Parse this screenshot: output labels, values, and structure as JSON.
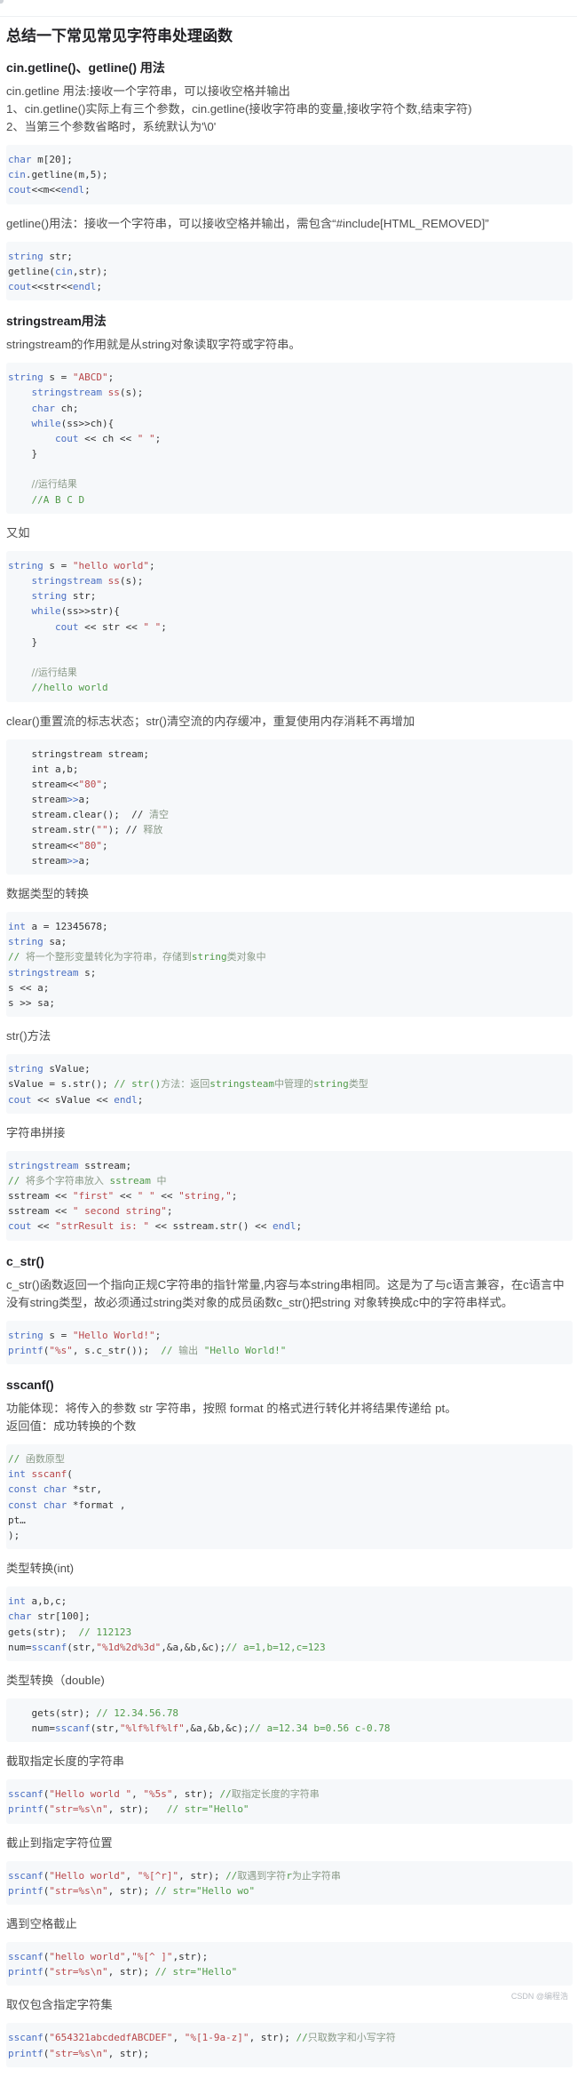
{
  "title": "总结一下常见常见字符串处理函数",
  "sections": [
    {
      "type": "h2",
      "text": "cin.getline()、getline() 用法"
    },
    {
      "type": "p",
      "lines": [
        "cin.getline 用法:接收一个字符串，可以接收空格并输出",
        "1、cin.getline()实际上有三个参数，cin.getline(接收字符串的变量,接收字符个数,结束字符)",
        "2、当第三个参数省略时，系统默认为'\\0'"
      ]
    },
    {
      "type": "code",
      "lines": [
        [
          [
            "kw",
            "char"
          ],
          [
            "p",
            " m[20];"
          ]
        ],
        [
          [
            "kw",
            "cin"
          ],
          [
            "p",
            ".getline(m,5);"
          ]
        ],
        [
          [
            "kw",
            "cout"
          ],
          [
            "p",
            "<<m<<"
          ],
          [
            "kw",
            "endl"
          ],
          [
            "p",
            ";"
          ]
        ]
      ]
    },
    {
      "type": "p",
      "lines": [
        "getline()用法：接收一个字符串，可以接收空格并输出，需包含“#include[HTML_REMOVED]”"
      ]
    },
    {
      "type": "code",
      "lines": [
        [
          [
            "kw",
            "string"
          ],
          [
            "p",
            " str;"
          ]
        ],
        [
          [
            "p",
            "getline("
          ],
          [
            "kw",
            "cin"
          ],
          [
            "p",
            ",str);"
          ]
        ],
        [
          [
            "kw",
            "cout"
          ],
          [
            "p",
            "<<str<<"
          ],
          [
            "kw",
            "endl"
          ],
          [
            "p",
            ";"
          ]
        ]
      ]
    },
    {
      "type": "h2",
      "text": "stringstream用法"
    },
    {
      "type": "p",
      "lines": [
        "stringstream的作用就是从string对象读取字符或字符串。"
      ]
    },
    {
      "type": "code",
      "lines": [
        [
          [
            "kw",
            "string"
          ],
          [
            "p",
            " s = "
          ],
          [
            "str",
            "\"ABCD\""
          ],
          [
            "p",
            ";"
          ]
        ],
        [
          [
            "p",
            "    "
          ],
          [
            "kw",
            "stringstream"
          ],
          [
            "p",
            " "
          ],
          [
            "fn",
            "ss"
          ],
          [
            "p",
            "(s);"
          ]
        ],
        [
          [
            "p",
            "    "
          ],
          [
            "kw",
            "char"
          ],
          [
            "p",
            " ch;"
          ]
        ],
        [
          [
            "p",
            "    "
          ],
          [
            "kw",
            "while"
          ],
          [
            "p",
            "(ss>>ch){"
          ]
        ],
        [
          [
            "p",
            "        "
          ],
          [
            "kw",
            "cout"
          ],
          [
            "p",
            " << ch << "
          ],
          [
            "str",
            "\" \""
          ],
          [
            "p",
            ";"
          ]
        ],
        [
          [
            "p",
            "    }"
          ]
        ],
        [
          [
            "p",
            ""
          ]
        ],
        [
          [
            "p",
            "    "
          ],
          [
            "cmcn",
            "//运行结果"
          ]
        ],
        [
          [
            "p",
            "    "
          ],
          [
            "cm",
            "//A B C D"
          ]
        ]
      ]
    },
    {
      "type": "label",
      "text": "又如"
    },
    {
      "type": "code",
      "lines": [
        [
          [
            "kw",
            "string"
          ],
          [
            "p",
            " s = "
          ],
          [
            "str",
            "\"hello world\""
          ],
          [
            "p",
            ";"
          ]
        ],
        [
          [
            "p",
            "    "
          ],
          [
            "kw",
            "stringstream"
          ],
          [
            "p",
            " "
          ],
          [
            "fn",
            "ss"
          ],
          [
            "p",
            "(s);"
          ]
        ],
        [
          [
            "p",
            "    "
          ],
          [
            "kw",
            "string"
          ],
          [
            "p",
            " str;"
          ]
        ],
        [
          [
            "p",
            "    "
          ],
          [
            "kw",
            "while"
          ],
          [
            "p",
            "(ss>>str){"
          ]
        ],
        [
          [
            "p",
            "        "
          ],
          [
            "kw",
            "cout"
          ],
          [
            "p",
            " << str << "
          ],
          [
            "str",
            "\" \""
          ],
          [
            "p",
            ";"
          ]
        ],
        [
          [
            "p",
            "    }"
          ]
        ],
        [
          [
            "p",
            ""
          ]
        ],
        [
          [
            "p",
            "    "
          ],
          [
            "cmcn",
            "//运行结果"
          ]
        ],
        [
          [
            "p",
            "    "
          ],
          [
            "cm",
            "//hello world"
          ]
        ]
      ]
    },
    {
      "type": "label",
      "text": "clear()重置流的标志状态；str()清空流的内存缓冲，重复使用内存消耗不再增加"
    },
    {
      "type": "code",
      "lines": [
        [
          [
            "p",
            "    stringstream stream;"
          ]
        ],
        [
          [
            "p",
            "    int a,b;"
          ]
        ],
        [
          [
            "p",
            "    stream<<"
          ],
          [
            "str",
            "\"80\""
          ],
          [
            "p",
            ";"
          ]
        ],
        [
          [
            "p",
            "    stream"
          ],
          [
            "kw",
            ">>"
          ],
          [
            "p",
            "a;"
          ]
        ],
        [
          [
            "p",
            "    stream.clear();  // "
          ],
          [
            "cmcn",
            "清空"
          ]
        ],
        [
          [
            "p",
            "    stream.str("
          ],
          [
            "str",
            "\"\""
          ],
          [
            "p",
            "); // "
          ],
          [
            "cmcn",
            "释放"
          ]
        ],
        [
          [
            "p",
            "    stream<<"
          ],
          [
            "str",
            "\"80\""
          ],
          [
            "p",
            ";"
          ]
        ],
        [
          [
            "p",
            "    stream"
          ],
          [
            "kw",
            ">>"
          ],
          [
            "p",
            "a;"
          ]
        ]
      ]
    },
    {
      "type": "label",
      "text": "数据类型的转换"
    },
    {
      "type": "code",
      "lines": [
        [
          [
            "kw",
            "int"
          ],
          [
            "p",
            " a = 12345678;"
          ]
        ],
        [
          [
            "kw",
            "string"
          ],
          [
            "p",
            " sa;"
          ]
        ],
        [
          [
            "cm",
            "// "
          ],
          [
            "cmcn",
            "将一个整形变量转化为字符串，存储到"
          ],
          [
            "cm",
            "string"
          ],
          [
            "cmcn",
            "类对象中"
          ]
        ],
        [
          [
            "kw",
            "stringstream"
          ],
          [
            "p",
            " s;"
          ]
        ],
        [
          [
            "p",
            "s << a;"
          ]
        ],
        [
          [
            "p",
            "s >> sa;"
          ]
        ]
      ]
    },
    {
      "type": "label",
      "text": "str()方法"
    },
    {
      "type": "code",
      "lines": [
        [
          [
            "kw",
            "string"
          ],
          [
            "p",
            " sValue;"
          ]
        ],
        [
          [
            "p",
            "sValue = s.str(); "
          ],
          [
            "cm",
            "// str()"
          ],
          [
            "cmcn",
            "方法：返回"
          ],
          [
            "cm",
            "stringsteam"
          ],
          [
            "cmcn",
            "中管理的"
          ],
          [
            "cm",
            "string"
          ],
          [
            "cmcn",
            "类型"
          ]
        ],
        [
          [
            "kw",
            "cout"
          ],
          [
            "p",
            " << sValue << "
          ],
          [
            "kw",
            "endl"
          ],
          [
            "p",
            ";"
          ]
        ]
      ]
    },
    {
      "type": "label",
      "text": "字符串拼接"
    },
    {
      "type": "code",
      "lines": [
        [
          [
            "kw",
            "stringstream"
          ],
          [
            "p",
            " sstream;"
          ]
        ],
        [
          [
            "cm",
            "// "
          ],
          [
            "cmcn",
            "将多个字符串放入"
          ],
          [
            "cm",
            " sstream "
          ],
          [
            "cmcn",
            "中"
          ]
        ],
        [
          [
            "p",
            "sstream << "
          ],
          [
            "str",
            "\"first\""
          ],
          [
            "p",
            " << "
          ],
          [
            "str",
            "\" \""
          ],
          [
            "p",
            " << "
          ],
          [
            "str",
            "\"string,\""
          ],
          [
            "p",
            ";"
          ]
        ],
        [
          [
            "p",
            "sstream << "
          ],
          [
            "str",
            "\" second string\""
          ],
          [
            "p",
            ";"
          ]
        ],
        [
          [
            "kw",
            "cout"
          ],
          [
            "p",
            " << "
          ],
          [
            "str",
            "\"strResult is: \""
          ],
          [
            "p",
            " << sstream.str() << "
          ],
          [
            "kw",
            "endl"
          ],
          [
            "p",
            ";"
          ]
        ]
      ]
    },
    {
      "type": "h2",
      "text": "c_str()"
    },
    {
      "type": "p",
      "lines": [
        "c_str()函数返回一个指向正规C字符串的指针常量,内容与本string串相同。这是为了与c语言兼容，在c语言中没有string类型，故必须通过string类对象的成员函数c_str()把string 对象转换成c中的字符串样式。"
      ]
    },
    {
      "type": "code",
      "lines": [
        [
          [
            "kw",
            "string"
          ],
          [
            "p",
            " s = "
          ],
          [
            "str",
            "\"Hello World!\""
          ],
          [
            "p",
            ";"
          ]
        ],
        [
          [
            "kw",
            "printf"
          ],
          [
            "p",
            "("
          ],
          [
            "str",
            "\"%s\""
          ],
          [
            "p",
            ", s.c_str());  "
          ],
          [
            "cm",
            "// "
          ],
          [
            "cmcn",
            "输出"
          ],
          [
            "cm",
            " \"Hello World!\""
          ]
        ]
      ]
    },
    {
      "type": "h2",
      "text": "sscanf()"
    },
    {
      "type": "p",
      "lines": [
        "功能体现：将传入的参数 str 字符串，按照 format 的格式进行转化并将结果传递给 pt。",
        "返回值：成功转换的个数"
      ]
    },
    {
      "type": "code",
      "lines": [
        [
          [
            "cm",
            "// "
          ],
          [
            "cmcn",
            "函数原型"
          ]
        ],
        [
          [
            "kw",
            "int"
          ],
          [
            "p",
            " "
          ],
          [
            "fn",
            "sscanf"
          ],
          [
            "p",
            "("
          ]
        ],
        [
          [
            "kw",
            "const"
          ],
          [
            "p",
            " "
          ],
          [
            "kw",
            "char"
          ],
          [
            "p",
            " *str,"
          ]
        ],
        [
          [
            "kw",
            "const"
          ],
          [
            "p",
            " "
          ],
          [
            "kw",
            "char"
          ],
          [
            "p",
            " *format ,"
          ]
        ],
        [
          [
            "p",
            "pt…"
          ]
        ],
        [
          [
            "p",
            ");"
          ]
        ]
      ]
    },
    {
      "type": "label",
      "text": "类型转换(int)"
    },
    {
      "type": "code",
      "lines": [
        [
          [
            "kw",
            "int"
          ],
          [
            "p",
            " a,b,c;"
          ]
        ],
        [
          [
            "kw",
            "char"
          ],
          [
            "p",
            " str[100];"
          ]
        ],
        [
          [
            "p",
            "gets(str);  "
          ],
          [
            "cm",
            "// 112123"
          ]
        ],
        [
          [
            "p",
            "num="
          ],
          [
            "kw",
            "sscanf"
          ],
          [
            "p",
            "(str,"
          ],
          [
            "str",
            "\"%1d%2d%3d\""
          ],
          [
            "p",
            ",&a,&b,&c);"
          ],
          [
            "cm",
            "// a=1,b=12,c=123"
          ]
        ]
      ]
    },
    {
      "type": "label",
      "text": "类型转换（double)"
    },
    {
      "type": "code",
      "lines": [
        [
          [
            "p",
            "    gets(str); "
          ],
          [
            "cm",
            "// 12.34.56.78"
          ]
        ],
        [
          [
            "p",
            "    num="
          ],
          [
            "kw",
            "sscanf"
          ],
          [
            "p",
            "(str,"
          ],
          [
            "str",
            "\"%lf%lf%lf\""
          ],
          [
            "p",
            ",&a,&b,&c);"
          ],
          [
            "cm",
            "// a=12.34 b=0.56 c-0.78"
          ]
        ]
      ]
    },
    {
      "type": "label",
      "text": "截取指定长度的字符串"
    },
    {
      "type": "code",
      "lines": [
        [
          [
            "kw",
            "sscanf"
          ],
          [
            "p",
            "("
          ],
          [
            "str",
            "\"Hello world \""
          ],
          [
            "p",
            ", "
          ],
          [
            "str",
            "\"%5s\""
          ],
          [
            "p",
            ", str); "
          ],
          [
            "cm",
            "//"
          ],
          [
            "cmcn",
            "取指定长度的字符串"
          ]
        ],
        [
          [
            "kw",
            "printf"
          ],
          [
            "p",
            "("
          ],
          [
            "str",
            "\"str=%s\\n\""
          ],
          [
            "p",
            ", str);   "
          ],
          [
            "cm",
            "// str=\"Hello\""
          ]
        ]
      ]
    },
    {
      "type": "label",
      "text": "截止到指定字符位置"
    },
    {
      "type": "code",
      "lines": [
        [
          [
            "kw",
            "sscanf"
          ],
          [
            "p",
            "("
          ],
          [
            "str",
            "\"Hello world\""
          ],
          [
            "p",
            ", "
          ],
          [
            "str",
            "\"%[^r]\""
          ],
          [
            "p",
            ", str); "
          ],
          [
            "cm",
            "//"
          ],
          [
            "cmcn",
            "取遇到字符"
          ],
          [
            "cm",
            "r"
          ],
          [
            "cmcn",
            "为止字符串"
          ]
        ],
        [
          [
            "kw",
            "printf"
          ],
          [
            "p",
            "("
          ],
          [
            "str",
            "\"str=%s\\n\""
          ],
          [
            "p",
            ", str); "
          ],
          [
            "cm",
            "// str=\"Hello wo\""
          ]
        ]
      ]
    },
    {
      "type": "label",
      "text": "遇到空格截止"
    },
    {
      "type": "code",
      "lines": [
        [
          [
            "kw",
            "sscanf"
          ],
          [
            "p",
            "("
          ],
          [
            "str",
            "\"hello world\""
          ],
          [
            "p",
            ","
          ],
          [
            "str",
            "\"%[^ ]\""
          ],
          [
            "p",
            ",str);"
          ]
        ],
        [
          [
            "kw",
            "printf"
          ],
          [
            "p",
            "("
          ],
          [
            "str",
            "\"str=%s\\n\""
          ],
          [
            "p",
            ", str); "
          ],
          [
            "cm",
            "// str=\"Hello\""
          ]
        ]
      ]
    },
    {
      "type": "label",
      "text": "取仅包含指定字符集"
    },
    {
      "type": "code",
      "lines": [
        [
          [
            "kw",
            "sscanf"
          ],
          [
            "p",
            "("
          ],
          [
            "str",
            "\"654321abcdedfABCDEF\""
          ],
          [
            "p",
            ", "
          ],
          [
            "str",
            "\"%[1-9a-z]\""
          ],
          [
            "p",
            ", str); "
          ],
          [
            "cm",
            "//"
          ],
          [
            "cmcn",
            "只取数字和小写字符"
          ]
        ],
        [
          [
            "kw",
            "printf"
          ],
          [
            "p",
            "("
          ],
          [
            "str",
            "\"str=%s\\n\""
          ],
          [
            "p",
            ", str);"
          ]
        ]
      ]
    }
  ],
  "watermark": "CSDN @编程浩",
  "colors": {
    "keyword": "#4a6fc3",
    "string": "#b9474a",
    "comment": "#4f9a48",
    "code_bg": "#f6f8fa",
    "heading": "#222226",
    "body_text": "#4d4d4d"
  }
}
